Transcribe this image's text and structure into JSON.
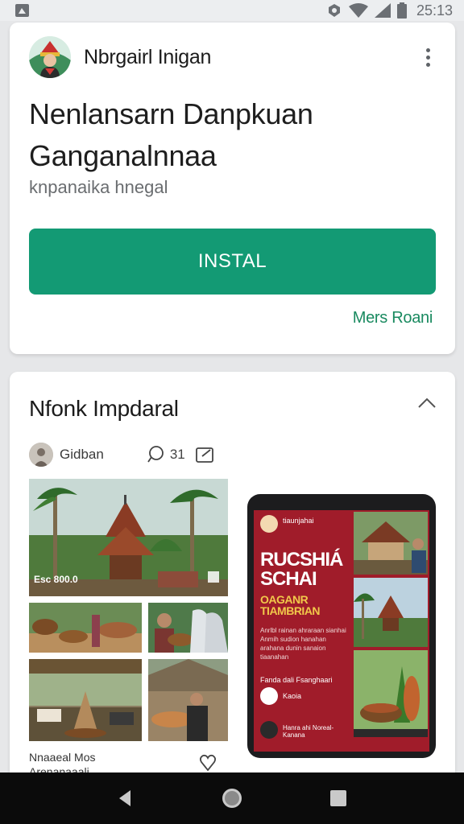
{
  "status_bar": {
    "time": "25:13",
    "icons": [
      "notification-icon",
      "dnd-icon",
      "wifi-icon",
      "signal-icon",
      "battery-icon"
    ]
  },
  "app_card": {
    "app_name": "Nbrgairl Inigan",
    "headline_line1": "Nenlansarn Danpkuan",
    "headline_line2": "Ganganalnnaa",
    "subtitle": "knpanaika hnegal",
    "install_label": "INSTAL",
    "more_label": "Mers Roani",
    "colors": {
      "install": "#139a74",
      "link": "#1a8a60"
    }
  },
  "post_card": {
    "title": "Nfonk Impdaral",
    "author": "Gidban",
    "comment_count": "31",
    "photo_caption": "Esc 800.0",
    "promo": {
      "small_text": "tiaunjahai",
      "title": "RUCSHIÁ SCHAI",
      "subtitle": "OAGANR TIAMBRIAN",
      "body": "Anrlbl rainan ahraraan sianhai Anmih sudion hanahan arahana dunin sanaion tiaanahan",
      "footer": "Fanda dali Fsanghaari",
      "user_a": "Kaoia",
      "user_b": "Hanra ahi Noreal-Kanana",
      "colors": {
        "background": "#a01c2a",
        "accent": "#f1c84a"
      }
    },
    "footer_line1": "Nnaaeal Mos",
    "footer_line2": "Arenanaaali"
  },
  "nav_bar": {
    "icons": [
      "back-icon",
      "home-icon",
      "recents-icon"
    ]
  }
}
